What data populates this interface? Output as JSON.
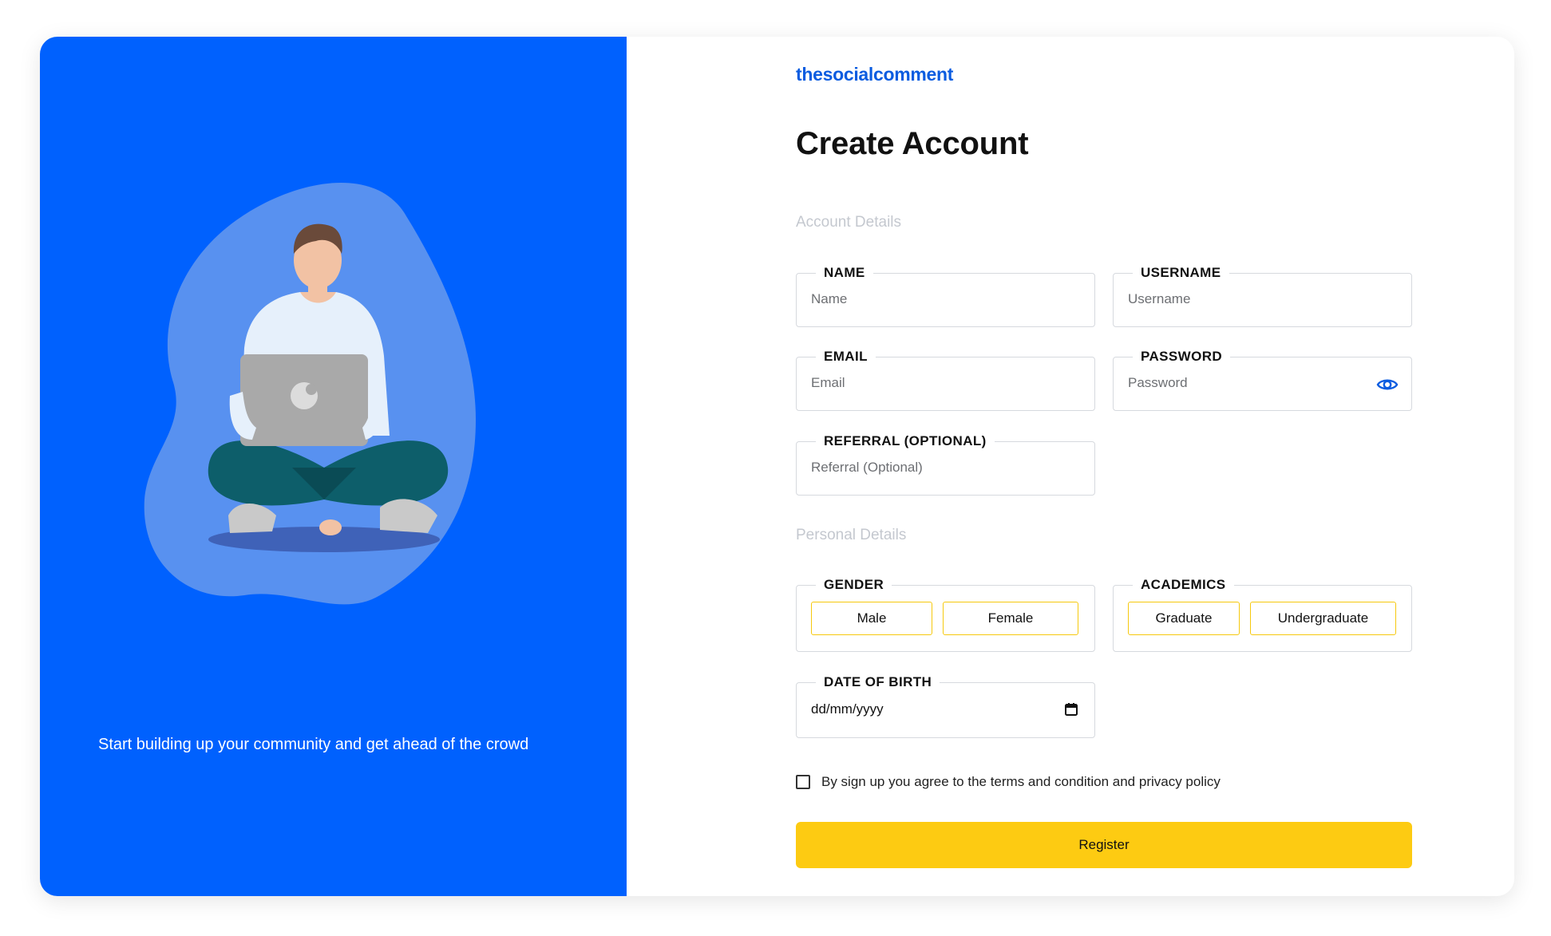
{
  "brand": {
    "name": "thesocialcomment"
  },
  "hero": {
    "tagline": "Start building up your community and get ahead of the crowd"
  },
  "page": {
    "title": "Create Account"
  },
  "account_section": {
    "heading": "Account Details",
    "name": {
      "label": "NAME",
      "placeholder": "Name"
    },
    "username": {
      "label": "USERNAME",
      "placeholder": "Username"
    },
    "email": {
      "label": "EMAIL",
      "placeholder": "Email"
    },
    "password": {
      "label": "PASSWORD",
      "placeholder": "Password",
      "icon": "eye-icon"
    },
    "referral": {
      "label": "REFERRAL (OPTIONAL)",
      "placeholder": "Referral (Optional)"
    }
  },
  "personal_section": {
    "heading": "Personal Details",
    "gender": {
      "label": "GENDER",
      "options": [
        "Male",
        "Female"
      ]
    },
    "academics": {
      "label": "ACADEMICS",
      "options": [
        "Graduate",
        "Undergraduate"
      ]
    },
    "dob": {
      "label": "DATE OF BIRTH",
      "value": "dd/mm/yyyy",
      "icon": "calendar-icon"
    }
  },
  "terms": {
    "text": "By sign up you agree to the terms and condition and privacy policy",
    "checked": false
  },
  "register_button": {
    "label": "Register"
  },
  "colors": {
    "hero_blue": "#0061fe",
    "brand_blue": "#0b5ce0",
    "accent_yellow": "#fdcb12",
    "choice_border": "#f6c90e"
  }
}
